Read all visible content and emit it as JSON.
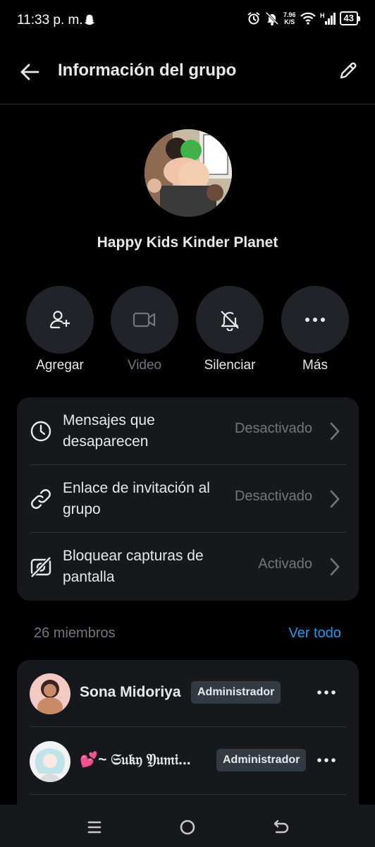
{
  "status_bar": {
    "time": "11:33 p. m.",
    "net_speed_value": "7.96",
    "net_speed_unit": "K/S",
    "battery": "43",
    "icons": [
      "snapchat-ghost-icon",
      "alarm-icon",
      "notifications-off-icon",
      "wifi-icon",
      "signal-icon",
      "battery-icon"
    ]
  },
  "header": {
    "title": "Información del grupo",
    "back_icon": "arrow-left-icon",
    "edit_icon": "pencil-icon"
  },
  "group": {
    "name": "Happy Kids Kinder Planet"
  },
  "actions": [
    {
      "label": "Agregar",
      "icon": "add-person-icon",
      "enabled": true
    },
    {
      "label": "Video",
      "icon": "video-camera-icon",
      "enabled": false
    },
    {
      "label": "Silenciar",
      "icon": "bell-off-icon",
      "enabled": true
    },
    {
      "label": "Más",
      "icon": "more-dots-icon",
      "enabled": true
    }
  ],
  "settings": [
    {
      "title": "Mensajes que desaparecen",
      "value": "Desactivado",
      "icon": "clock-icon"
    },
    {
      "title": "Enlace de invitación al grupo",
      "value": "Desactivado",
      "icon": "link-icon"
    },
    {
      "title": "Bloquear capturas de pantalla",
      "value": "Activado",
      "icon": "screenshot-blocked-icon"
    }
  ],
  "members": {
    "count_label": "26 miembros",
    "see_all": "Ver todo",
    "items": [
      {
        "name": "Sona Midoriya",
        "badge": "Administrador"
      },
      {
        "name": "💕~ 𝔖𝔲𝔨𝔶 𝔜𝔲𝔪𝔦...",
        "badge": "Administrador"
      }
    ]
  },
  "colors": {
    "background": "#000000",
    "card": "#16181c",
    "accent": "#1d9bf0",
    "muted_text": "#71767b",
    "badge": "#333a41"
  }
}
